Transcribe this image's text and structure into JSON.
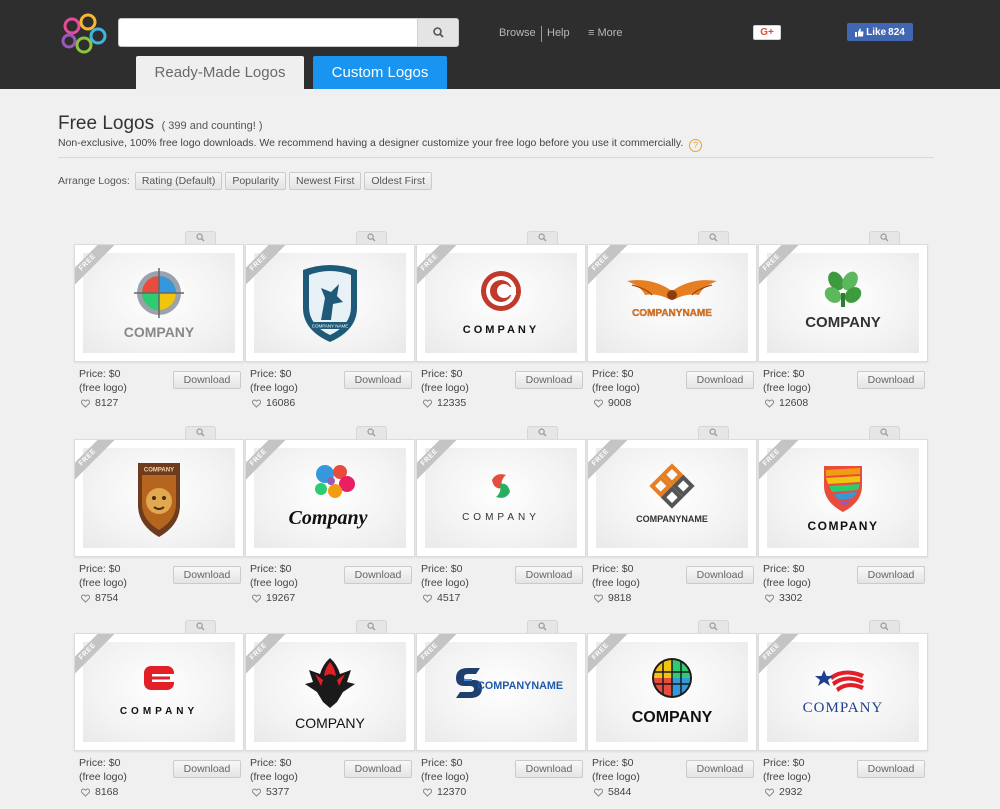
{
  "header": {
    "search": {
      "value": "",
      "placeholder": ""
    },
    "nav": {
      "browse": "Browse",
      "help": "Help",
      "more": "≡ More"
    },
    "gplus_label": "G+",
    "fb_like_label": "Like",
    "fb_like_count": "824",
    "tabs": [
      {
        "label": "Ready-Made Logos",
        "active": true
      },
      {
        "label": "Custom Logos",
        "active": false
      }
    ],
    "accent": "#1994f0"
  },
  "intro": {
    "title": "Free Logos",
    "count_note": "( 399 and counting! )",
    "subtitle": "Non-exclusive, 100% free logo downloads. We recommend having a designer customize your free logo before you use it commercially.",
    "help_icon_glyph": "?"
  },
  "arrange": {
    "label": "Arrange Logos:",
    "options": [
      "Rating (Default)",
      "Popularity",
      "Newest First",
      "Oldest First"
    ]
  },
  "card_common": {
    "ribbon": "FREE",
    "price": "Price: $0",
    "free_note": "(free logo)",
    "download_label": "Download"
  },
  "logos": [
    {
      "icon": "globe-compass-logo",
      "text": "COMPANY",
      "downloads": "8127"
    },
    {
      "icon": "pegasus-shield-logo",
      "text": "COMPANY NAME",
      "downloads": "16086"
    },
    {
      "icon": "red-c-circle-logo",
      "text": "COMPANY",
      "downloads": "12335"
    },
    {
      "icon": "orange-wings-logo",
      "text": "COMPANYNAME",
      "downloads": "9008"
    },
    {
      "icon": "green-tree-logo",
      "text": "COMPANY",
      "downloads": "12608"
    },
    {
      "icon": "lion-shield-logo",
      "text": "COMPANY",
      "downloads": "8754"
    },
    {
      "icon": "colorful-dots-logo",
      "text": "Company",
      "downloads": "19267"
    },
    {
      "icon": "red-green-sphere-logo",
      "text": "COMPANY",
      "downloads": "4517"
    },
    {
      "icon": "orange-square-arrows-logo",
      "text": "COMPANYNAME",
      "downloads": "9818"
    },
    {
      "icon": "rainbow-shield-logo",
      "text": "COMPANY",
      "downloads": "3302"
    },
    {
      "icon": "red-c-block-logo",
      "text": "COMPANY",
      "downloads": "8168"
    },
    {
      "icon": "red-eagle-logo",
      "text": "COMPANY",
      "downloads": "5377"
    },
    {
      "icon": "blue-s-logo",
      "text": "COMPANYNAME",
      "downloads": "12370"
    },
    {
      "icon": "striped-globe-logo",
      "text": "COMPANY",
      "downloads": "5844"
    },
    {
      "icon": "flag-star-logo",
      "text": "COMPANY",
      "downloads": "2932"
    }
  ]
}
